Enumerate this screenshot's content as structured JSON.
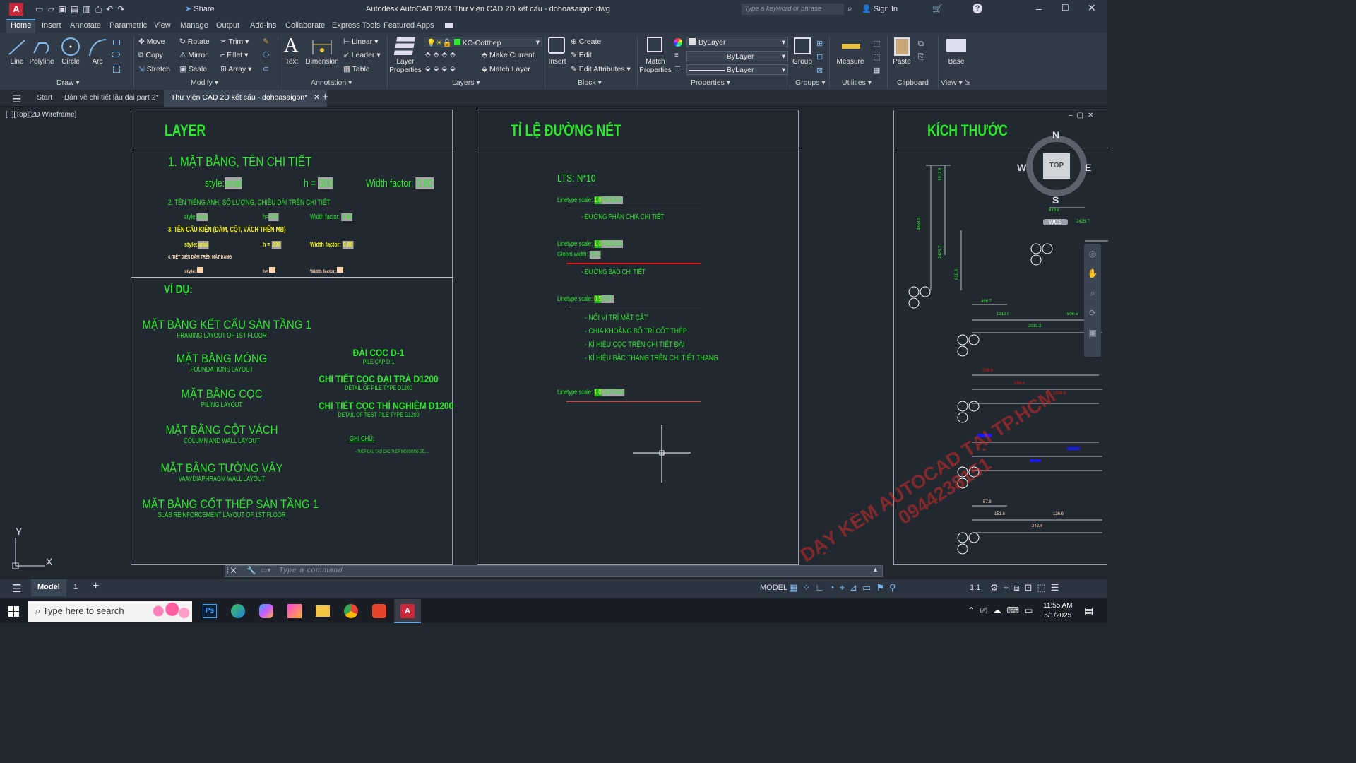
{
  "titlebar": {
    "share": "Share",
    "title": "Autodesk AutoCAD 2024   Thư viện CAD 2D kết cấu - dohoasaigon.dwg",
    "search_placeholder": "Type a keyword or phrase",
    "sign_in": "Sign In"
  },
  "ribbon_tabs": [
    "Home",
    "Insert",
    "Annotate",
    "Parametric",
    "View",
    "Manage",
    "Output",
    "Add-ins",
    "Collaborate",
    "Express Tools",
    "Featured Apps"
  ],
  "ribbon": {
    "draw": {
      "line": "Line",
      "polyline": "Polyline",
      "circle": "Circle",
      "arc": "Arc",
      "panel": "Draw"
    },
    "modify": {
      "move": "Move",
      "rotate": "Rotate",
      "trim": "Trim",
      "copy": "Copy",
      "mirror": "Mirror",
      "fillet": "Fillet",
      "stretch": "Stretch",
      "scale": "Scale",
      "array": "Array",
      "panel": "Modify"
    },
    "annotation": {
      "text": "Text",
      "dimension": "Dimension",
      "linear": "Linear",
      "leader": "Leader",
      "table": "Table",
      "panel": "Annotation"
    },
    "layers": {
      "layer_properties": "Layer Properties",
      "current_layer": "KC-Cotthep",
      "make_current": "Make Current",
      "match_layer": "Match Layer",
      "panel": "Layers"
    },
    "block": {
      "insert": "Insert",
      "create": "Create",
      "edit": "Edit",
      "edit_attributes": "Edit Attributes",
      "panel": "Block"
    },
    "properties": {
      "match": "Match Properties",
      "bylayer1": "ByLayer",
      "bylayer2": "ByLayer",
      "bylayer3": "ByLayer",
      "panel": "Properties"
    },
    "groups": {
      "group": "Group",
      "panel": "Groups"
    },
    "utilities": {
      "measure": "Measure",
      "panel": "Utilities"
    },
    "clipboard": {
      "paste": "Paste",
      "panel": "Clipboard"
    },
    "view": {
      "base": "Base",
      "panel": "View"
    }
  },
  "doctabs": {
    "start": "Start",
    "tab1": "Bản vẽ chi tiết lầu đài part 2*",
    "tab2": "Thư viện CAD 2D kết cấu - dohoasaigon*"
  },
  "viewport_label": "[−][Top][2D Wireframe]",
  "sheet1": {
    "title": "LAYER",
    "h1": "1. MẶT BẰNG, TÊN CHI TIẾT",
    "style_lbl": "style:",
    "style_val": "arial",
    "h_lbl": "h =",
    "h_val": "300",
    "wf_lbl": "Width factor:",
    "wf_val": "0.80",
    "h2": "2. TÊN TIẾNG ANH, SỐ LƯỢNG, CHIỀU DÀI TRÊN CHI TIẾT",
    "s2_style": "style:",
    "s2_style_val": "arial",
    "s2_h": "h=",
    "s2_h_val": "200",
    "s2_wf": "Width factor:",
    "s2_wf_val": "0.80",
    "h3": "3. TÊN CẤU KIỆN (DẦM, CỘT, VÁCH TRÊN MB)",
    "s3_style": "style:",
    "s3_style_val": "arial",
    "s3_h": "h =",
    "s3_h_val": "200",
    "s3_wf": "Width factor:",
    "s3_wf_val": "0.80",
    "h4": "4. TIẾT DIỆN DẦM TRÊN MẶT BẰNG",
    "s4_style": "style:",
    "s4_h": "h=",
    "s4_wf": "Width factor:",
    "example": "VÍ DỤ:",
    "items": [
      {
        "vi": "MẶT BẰNG KẾT CẤU SÀN TẦNG 1",
        "en": "FRAMING LAYOUT OF 1ST FLOOR"
      },
      {
        "vi": "MẶT BẰNG MÓNG",
        "en": "FOUNDATIONS LAYOUT"
      },
      {
        "vi": "MẶT BẰNG CỌC",
        "en": "PILING LAYOUT"
      },
      {
        "vi": "MẶT BẰNG CỘT VÁCH",
        "en": "COLUMN AND WALL LAYOUT"
      },
      {
        "vi": "MẶT BẰNG TƯỜNG VÂY",
        "en": "VAAYDIAPHRAGM WALL LAYOUT"
      },
      {
        "vi": "MẶT BẰNG CỐT THÉP SÀN TẦNG 1",
        "en": "SLAB REINFORCEMENT LAYOUT OF 1ST FLOOR"
      }
    ],
    "right": [
      {
        "vi": "ĐÀI CỌC D-1",
        "en": "PILE CAP D-1"
      },
      {
        "vi": "CHI TIẾT CỌC ĐẠI TRÀ D1200",
        "en": "DETAIL OF PILE TYPE D1200"
      },
      {
        "vi": "CHI TIẾT CỌC THÍ NGHIỆM D1200",
        "en": "DETAIL OF TEST PILE TYPE D1200"
      }
    ],
    "note_title": "GHI CHÚ:",
    "note_text": "- THÉP CẤU TẠO CÁC THÉP MỖI ĐÔNG ĐỂ....."
  },
  "sheet2": {
    "title": "TỈ LỆ ĐƯỜNG NÉT",
    "lts": "LTS: N*10",
    "lt1_lbl": "Linetype scale:",
    "lt1_val": "1.0",
    "lt1_type": "HIDDEN",
    "lt1_desc": "- ĐƯỜNG PHÂN CHIA CHI TIẾT",
    "lt2_lbl": "Linetype scale:",
    "lt2_val": "1.0",
    "lt2_type": "HIDDEN",
    "gw_lbl": "Global width:",
    "gw_val": "25.0",
    "lt2_desc": "- ĐƯỜNG BAO CHI TIẾT",
    "lt3_lbl": "Linetype scale:",
    "lt3_val": "0.5",
    "lt3_type": "DOT",
    "lt3_desc": [
      "- NỐI VỊ TRÍ MẶT CẮT",
      "- CHIA KHOẢNG BỐ TRÍ CỐT THÉP",
      "- KÍ HIỆU CỌC TRÊN CHI TIẾT ĐÀI",
      "- KÍ HIỆU BẬC THANG TRÊN CHI TIẾT THANG"
    ],
    "lt4_lbl": "Linetype scale:",
    "lt4_val": "1.0",
    "lt4_type": "CENTER"
  },
  "sheet3": {
    "title": "KÍCH THƯỚC",
    "dims": {
      "d1": "1912.8",
      "d2": "4868.9",
      "d3": "2425.7",
      "d4": "619.8",
      "d5": "619.8",
      "d6": "2425.7",
      "d7": "486.7",
      "d8": "1212.0",
      "d9": "606.5",
      "d10": "2019.3",
      "d11": "236.6",
      "d12": "566.4",
      "d13": "1009.6",
      "d14": "57.8",
      "d15": "151.6",
      "d16": "126.6",
      "d17": "242.4"
    },
    "tags": {
      "t1": "1",
      "t2": "A",
      "t3": "A",
      "t4": "1",
      "t5": "1",
      "t6": "1",
      "t7": "1",
      "t8": "1"
    }
  },
  "viewcube": {
    "n": "N",
    "s": "S",
    "e": "E",
    "w": "W",
    "top": "TOP",
    "wcs": "WCS"
  },
  "watermark": {
    "line1": "DẠY KÈM AUTOCAD TẠI TP.HCM",
    "line2": "0944238151"
  },
  "ucs": {
    "x": "X",
    "y": "Y"
  },
  "command": {
    "placeholder": "Type a command"
  },
  "status": {
    "model_tab": "Model",
    "layout": "1",
    "model_btn": "MODEL",
    "scale": "1:1"
  },
  "taskbar": {
    "search": "Type here to search",
    "time": "11:55 AM",
    "date": "5/1/2025"
  }
}
